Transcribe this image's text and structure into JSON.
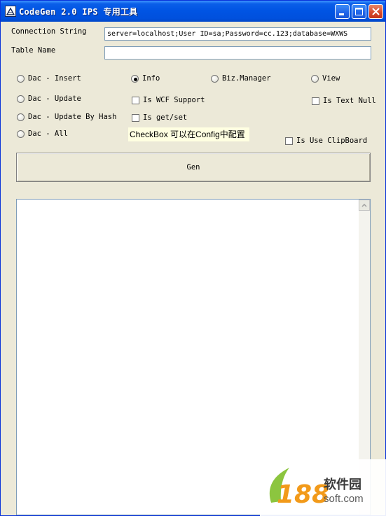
{
  "window": {
    "title": "CodeGen 2.0 IPS 专用工具"
  },
  "form": {
    "connection_label": "Connection String",
    "connection_value": "server=localhost;User ID=sa;Password=cc.123;database=WXWS",
    "table_label": "Table Name",
    "table_value": ""
  },
  "radios": {
    "dac_insert": "Dac - Insert",
    "dac_update": "Dac - Update",
    "dac_update_by_hash": "Dac - Update By Hash",
    "dac_all": "Dac - All",
    "info": "Info",
    "biz_manager": "Biz.Manager",
    "view": "View",
    "selected": "Info"
  },
  "checks": {
    "wcf_support": "Is WCF Support",
    "get_set": "Is get/set",
    "text_null": "Is Text Null",
    "use_clipboard": "Is Use ClipBoard"
  },
  "note": "CheckBox 可以在Config中配置",
  "gen_button": "Gen",
  "output_text": "",
  "watermark": {
    "cn": "软件园",
    "en": "soft.com",
    "number": "188"
  },
  "colors": {
    "titlebar": "#0054e3",
    "window_bg": "#ece9d8",
    "close_button": "#d6462a",
    "note_bg": "#ffffe1",
    "watermark_orange": "#f29a1a",
    "watermark_green": "#7fbf2a"
  },
  "icons": [
    "app-icon",
    "minimize-icon",
    "maximize-icon",
    "close-icon",
    "scroll-up-arrow-icon"
  ]
}
